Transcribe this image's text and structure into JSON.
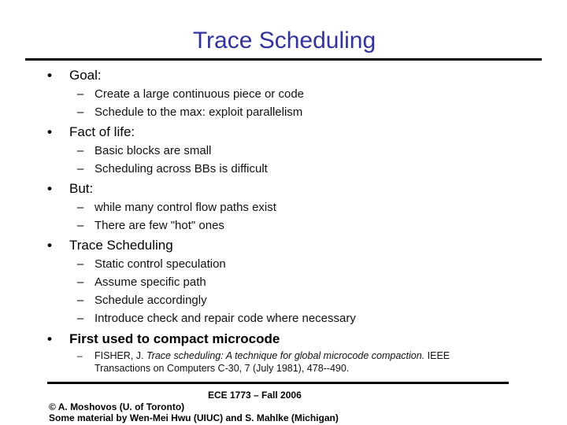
{
  "slide": {
    "title": "Trace Scheduling",
    "bullet_glyph": "•",
    "dash_glyph": "–",
    "bullets": [
      {
        "label": "Goal:",
        "subitems": [
          "Create a large continuous piece or code",
          "Schedule to the max: exploit parallelism"
        ]
      },
      {
        "label": "Fact of life:",
        "subitems": [
          "Basic blocks are small",
          "Scheduling across BBs is difficult"
        ]
      },
      {
        "label": "But:",
        "subitems": [
          "while many control flow paths exist",
          "There are few \"hot\" ones"
        ]
      },
      {
        "label": "Trace Scheduling",
        "subitems": [
          "Static control speculation",
          "Assume specific path",
          "Schedule accordingly",
          "Introduce check and repair code where necessary"
        ]
      },
      {
        "label": "First used to compact microcode",
        "reference": {
          "author": "FISHER, J. ",
          "title": "Trace scheduling: A technique for global microcode compaction.",
          "rest": " IEEE Transactions on Computers C-30, 7 (July 1981), 478--490."
        }
      }
    ]
  },
  "footer": {
    "course": "ECE 1773 – Fall 2006",
    "copyright": "© A. Moshovos (U. of Toronto)",
    "credits": "Some material by Wen-Mei Hwu (UIUC) and S. Mahlke (Michigan)"
  }
}
